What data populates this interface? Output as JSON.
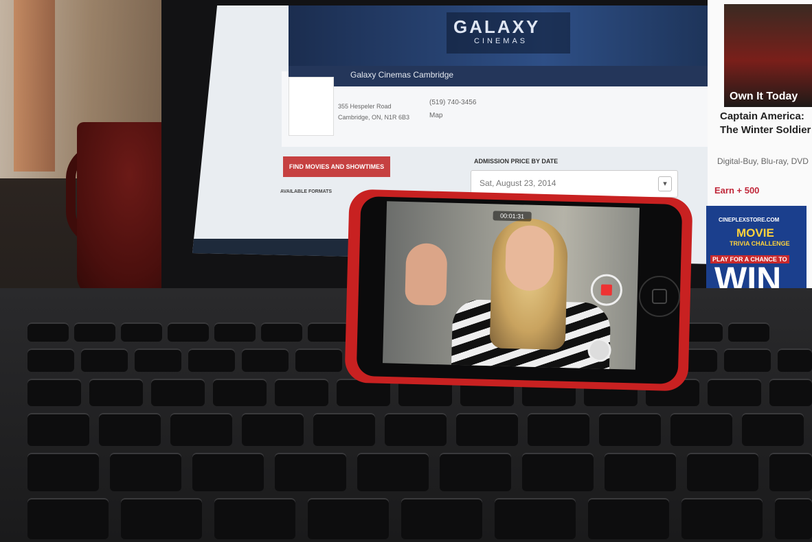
{
  "website": {
    "brand_name": "GALAXY",
    "brand_sub": "CINEMAS",
    "theatre_name": "Galaxy Cinemas Cambridge",
    "address_line1": "355 Hespeler Road",
    "address_line2": "Cambridge, ON, N1R 6B3",
    "phone": "(519) 740-3456",
    "map_label": "Map",
    "find_button": "FIND MOVIES AND SHOWTIMES",
    "formats_label": "AVAILABLE FORMATS",
    "admission_label": "ADMISSION PRICE BY DATE",
    "date_value": "Sat, August 23, 2014"
  },
  "ad": {
    "tagline": "Own It Today",
    "movie_title": "Captain America: The Winter Soldier",
    "formats": "Digital-Buy, Blu-ray, DVD",
    "earn": "Earn + 500"
  },
  "trivia_ad": {
    "store": "CINEPLEXSTORE.COM",
    "movie": "MOVIE",
    "subtitle": "TRIVIA CHALLENGE",
    "play": "PLAY FOR A CHANCE TO",
    "win": "WIN"
  },
  "phone_camera": {
    "timer": "00:01:31",
    "record_color": "#e33333"
  },
  "colors": {
    "phone_case": "#c82121",
    "brand_blue": "#1b2d4f",
    "cta_red": "#c64141"
  }
}
